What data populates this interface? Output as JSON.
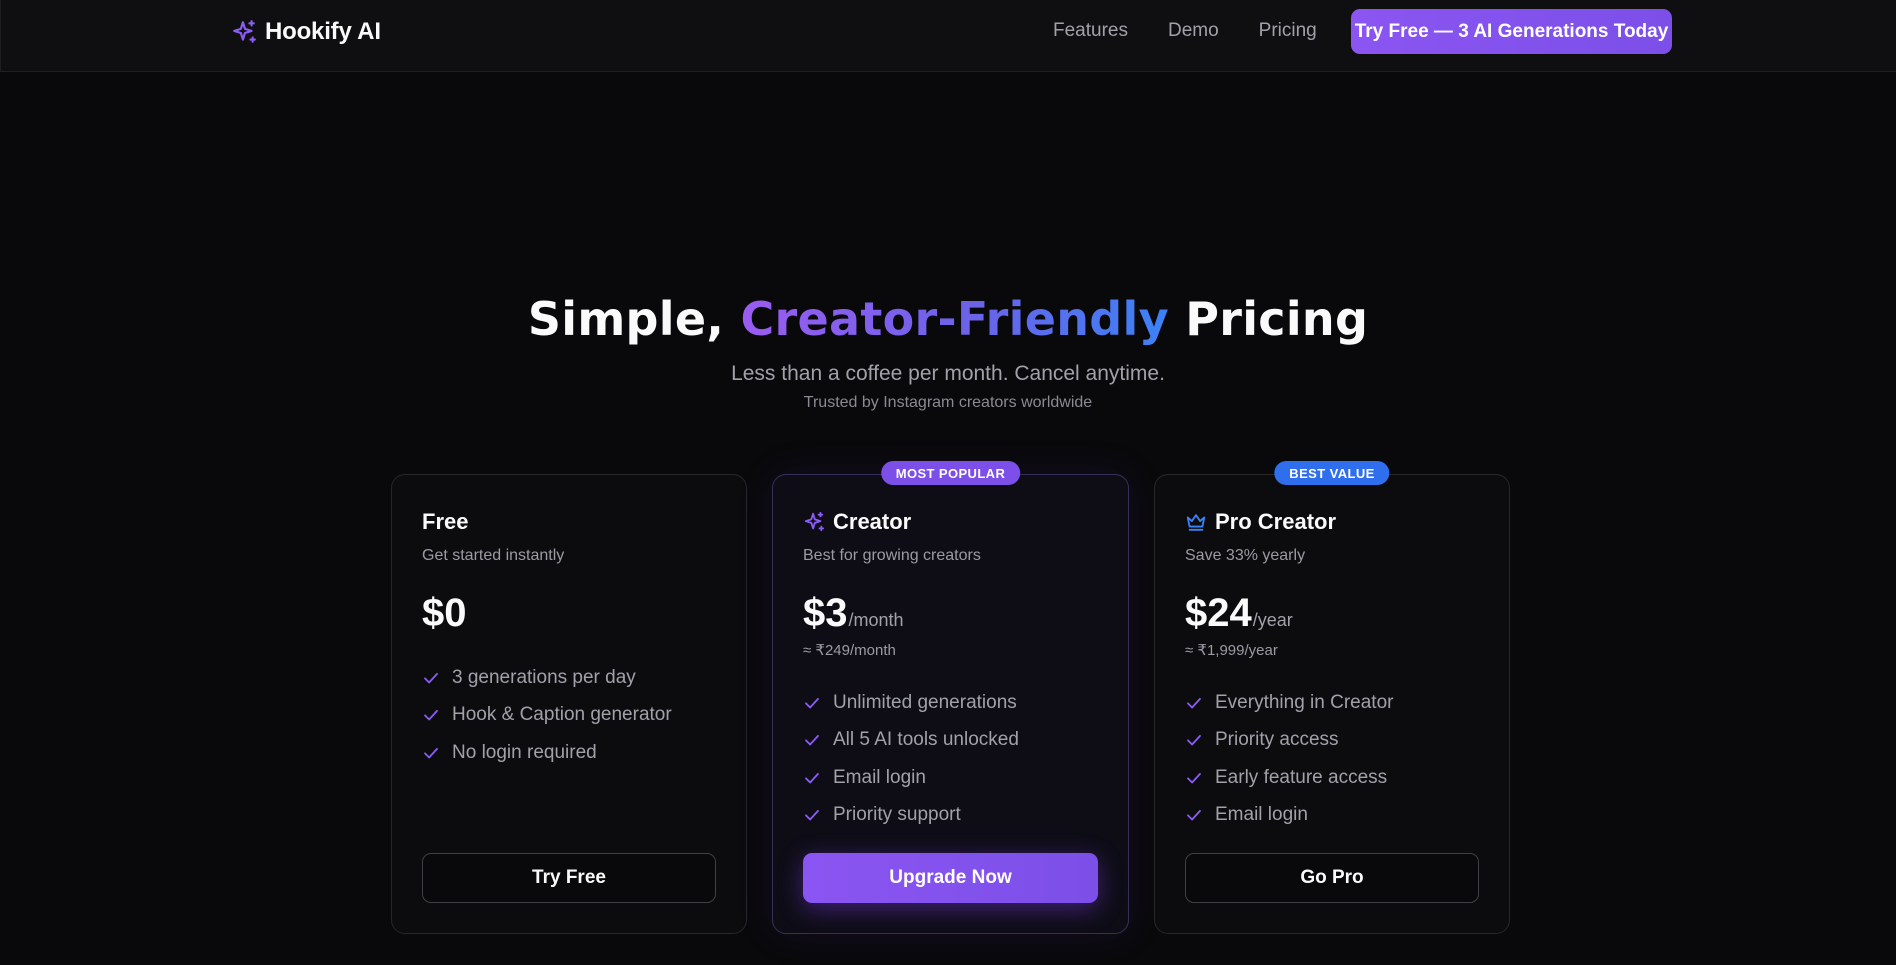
{
  "nav": {
    "brand_icon": "sparkles-icon",
    "brand": "Hookify AI",
    "links": [
      "Features",
      "Demo",
      "Pricing"
    ],
    "cta": "Try Free — 3 AI Generations Today"
  },
  "hero": {
    "title_pre": "Simple, ",
    "title_highlight": "Creator-Friendly",
    "title_post": " Pricing",
    "subtitle": "Less than a coffee per month. Cancel anytime.",
    "trust": "Trusted by Instagram creators worldwide"
  },
  "plans": [
    {
      "name": "Free",
      "icon": "",
      "badge": "",
      "desc": "Get started instantly",
      "price": "$0",
      "period": "",
      "alt": "",
      "features": [
        "3 generations per day",
        "Hook & Caption generator",
        "No login required"
      ],
      "cta": "Try Free"
    },
    {
      "name": "Creator",
      "icon": "sparkles-icon",
      "badge": "MOST POPULAR",
      "desc": "Best for growing creators",
      "price": "$3",
      "period": "/month",
      "alt": "≈ ₹249/month",
      "features": [
        "Unlimited generations",
        "All 5 AI tools unlocked",
        "Email login",
        "Priority support"
      ],
      "cta": "Upgrade Now"
    },
    {
      "name": "Pro Creator",
      "icon": "crown-icon",
      "badge": "BEST VALUE",
      "desc": "Save 33% yearly",
      "price": "$24",
      "period": "/year",
      "alt": "≈ ₹1,999/year",
      "features": [
        "Everything in Creator",
        "Priority access",
        "Early feature access",
        "Email login"
      ],
      "cta": "Go Pro"
    }
  ],
  "colors": {
    "background": "#09090b",
    "accent": "#8b5cf6",
    "badge_blue": "#2f6fee",
    "check": "#8b5cf6",
    "crown": "#3b82f6"
  }
}
